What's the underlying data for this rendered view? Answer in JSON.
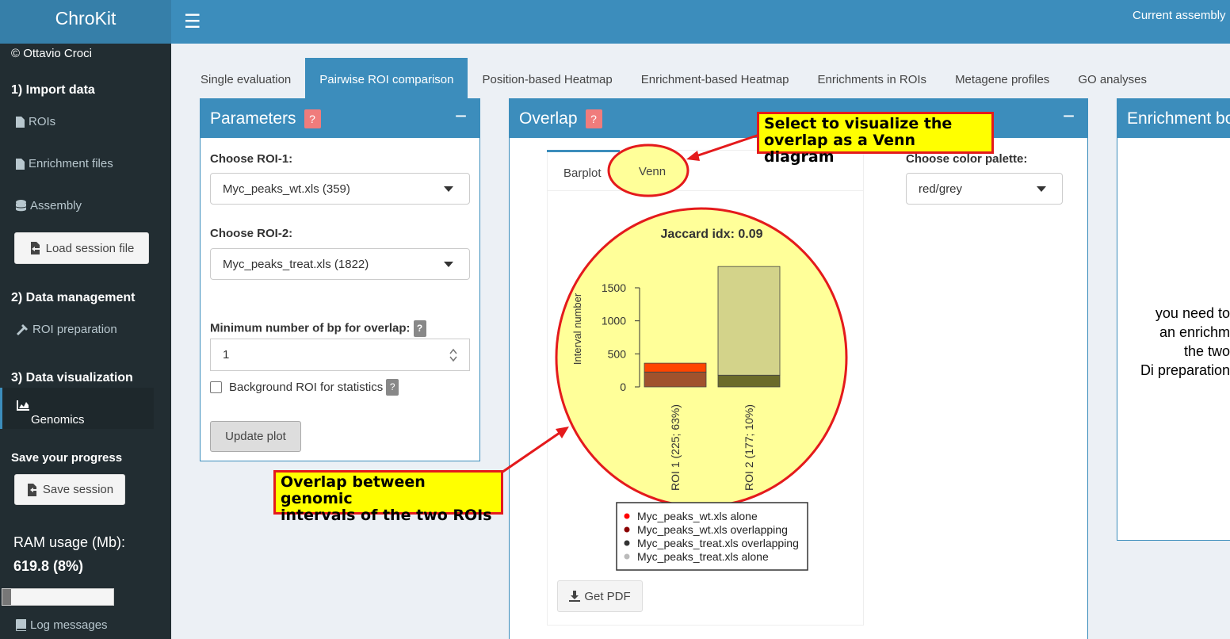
{
  "app": {
    "title": "ChroKit",
    "credit": "© Ottavio Croci",
    "current_assembly": "Current assembly"
  },
  "sidebar": {
    "section1": "1) Import data",
    "rois": "ROIs",
    "enrichment_files": "Enrichment files",
    "assembly": "Assembly",
    "load_session": "Load session file",
    "section2": "2) Data management",
    "roi_preparation": "ROI preparation",
    "section3": "3) Data visualization",
    "genomics": "Genomics",
    "save_progress": "Save your progress",
    "save_session": "Save session",
    "ram_label": "RAM usage (Mb):",
    "ram_value": "619.8 (8%)",
    "ram_fraction": 0.08,
    "log_messages": "Log messages"
  },
  "tabs": [
    "Single evaluation",
    "Pairwise ROI comparison",
    "Position-based Heatmap",
    "Enrichment-based Heatmap",
    "Enrichments in ROIs",
    "Metagene profiles",
    "GO analyses"
  ],
  "parameters": {
    "title": "Parameters",
    "help": "?",
    "choose_roi1": "Choose ROI-1:",
    "roi1_value": "Myc_peaks_wt.xls (359)",
    "choose_roi2": "Choose ROI-2:",
    "roi2_value": "Myc_peaks_treat.xls (1822)",
    "min_bp_label": "Minimum number of bp for overlap:",
    "min_bp_value": "1",
    "background_label": "Background ROI for statistics",
    "update_plot": "Update plot"
  },
  "overlap": {
    "title": "Overlap",
    "help": "?",
    "subtab_barplot": "Barplot",
    "subtab_venn": "Venn",
    "palette_label": "Choose color palette:",
    "palette_value": "red/grey",
    "get_pdf": "Get PDF"
  },
  "enrichment": {
    "title": "Enrichment bo",
    "msg_lines": [
      "you need to",
      "an enrichm",
      "the two",
      "Di preparation"
    ]
  },
  "callouts": {
    "venn": [
      "Select to visualize the",
      "overlap as a Venn diagram"
    ],
    "overlap": [
      "Overlap between genomic",
      "intervals of the two ROIs"
    ]
  },
  "colors": {
    "accent": "#3c8dbc",
    "wt_alone": "#ff4500",
    "wt_overlap": "#a0522d",
    "treat_overlap": "#6b6b2a",
    "treat_alone": "#d3d38a",
    "highlight": "#ffff99",
    "callout_border": "#e41a1c"
  },
  "chart_data": {
    "type": "bar",
    "title": "Jaccard idx: 0.09",
    "ylabel": "Interval number",
    "categories": [
      "ROI 1 (225; 63%)",
      "ROI 2 (177; 10%)"
    ],
    "series": [
      {
        "name": "Myc_peaks_wt.xls alone",
        "values": [
          134,
          0
        ]
      },
      {
        "name": "Myc_peaks_wt.xls overlapping",
        "values": [
          225,
          0
        ]
      },
      {
        "name": "Myc_peaks_treat.xls overlapping",
        "values": [
          0,
          177
        ]
      },
      {
        "name": "Myc_peaks_treat.xls alone",
        "values": [
          0,
          1645
        ]
      }
    ],
    "yticks": [
      0,
      500,
      1000,
      1500
    ],
    "ylim": [
      0,
      1822
    ],
    "legend_colors": [
      "#ff0000",
      "#8b0000",
      "#333333",
      "#bbbbbb"
    ],
    "legend": [
      "Myc_peaks_wt.xls alone",
      "Myc_peaks_wt.xls overlapping",
      "Myc_peaks_treat.xls overlapping",
      "Myc_peaks_treat.xls alone"
    ]
  }
}
